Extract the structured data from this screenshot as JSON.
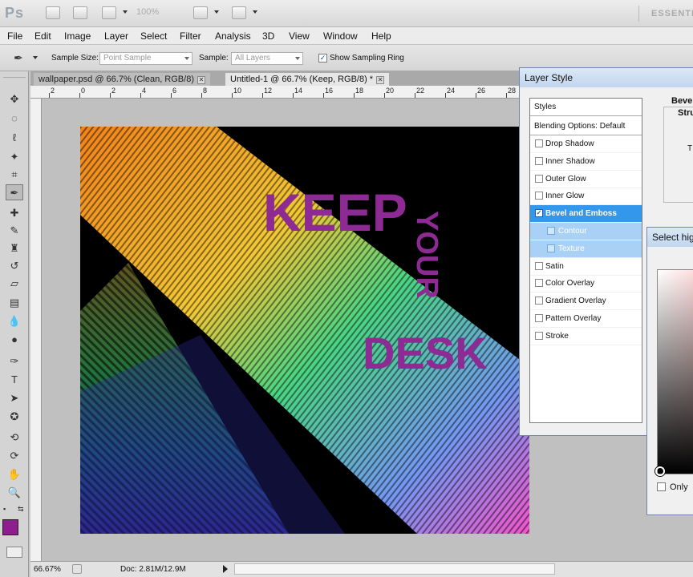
{
  "app": {
    "logo": "Ps",
    "zoom": "100%",
    "workspace": "ESSENTI"
  },
  "menu": [
    "File",
    "Edit",
    "Image",
    "Layer",
    "Select",
    "Filter",
    "Analysis",
    "3D",
    "View",
    "Window",
    "Help"
  ],
  "options": {
    "sample_size_label": "Sample Size:",
    "sample_size_value": "Point Sample",
    "sample_label": "Sample:",
    "sample_value": "All Layers",
    "show_ring_label": "Show Sampling Ring",
    "show_ring_checked": true
  },
  "tabs": [
    {
      "label": "wallpaper.psd @ 66.7% (Clean, RGB/8)",
      "active": false
    },
    {
      "label": "Untitled-1 @ 66.7% (Keep, RGB/8) *",
      "active": true
    }
  ],
  "ruler_ticks": [
    "2",
    "0",
    "2",
    "4",
    "6",
    "8",
    "10",
    "12",
    "14",
    "16",
    "18",
    "20",
    "22",
    "24",
    "26",
    "28"
  ],
  "artwork": {
    "word1": "KEEP",
    "word2": "YOUR",
    "word3": "DESK",
    "text_color": "#8e2a94"
  },
  "status": {
    "zoom": "66.67%",
    "doc": "Doc: 2.81M/12.9M"
  },
  "foreground_color": "#8e1e8e",
  "layer_style": {
    "title": "Layer Style",
    "styles_header": "Styles",
    "blending": "Blending Options: Default",
    "items": [
      {
        "label": "Drop Shadow",
        "checked": false,
        "state": "normal"
      },
      {
        "label": "Inner Shadow",
        "checked": false,
        "state": "normal"
      },
      {
        "label": "Outer Glow",
        "checked": false,
        "state": "normal"
      },
      {
        "label": "Inner Glow",
        "checked": false,
        "state": "normal"
      },
      {
        "label": "Bevel and Emboss",
        "checked": true,
        "state": "selected"
      },
      {
        "label": "Contour",
        "checked": false,
        "state": "sub"
      },
      {
        "label": "Texture",
        "checked": false,
        "state": "sub"
      },
      {
        "label": "Satin",
        "checked": false,
        "state": "normal"
      },
      {
        "label": "Color Overlay",
        "checked": false,
        "state": "normal"
      },
      {
        "label": "Gradient Overlay",
        "checked": false,
        "state": "normal"
      },
      {
        "label": "Pattern Overlay",
        "checked": false,
        "state": "normal"
      },
      {
        "label": "Stroke",
        "checked": false,
        "state": "normal"
      }
    ],
    "pane_title": "Bevel",
    "pane_sub": "Stru",
    "pane_t": "T"
  },
  "picker": {
    "title": "Select hig",
    "only_label": "Only"
  }
}
